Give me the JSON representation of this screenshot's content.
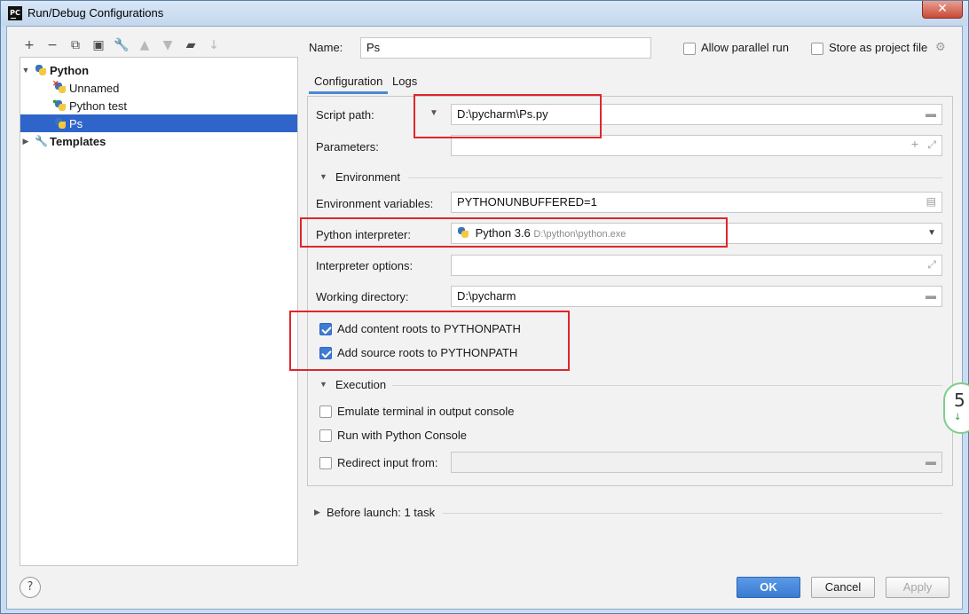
{
  "window": {
    "title": "Run/Debug Configurations",
    "app_icon_text": "PC"
  },
  "toolbar": {
    "icons": [
      "add-icon",
      "remove-icon",
      "copy-icon",
      "save-icon",
      "wrench-icon",
      "move-up-icon",
      "move-down-icon",
      "folder-icon",
      "sort-icon"
    ]
  },
  "tree": {
    "python": "Python",
    "items": [
      "Unnamed",
      "Python test",
      "Ps"
    ],
    "templates": "Templates"
  },
  "header": {
    "name_label": "Name:",
    "name_value": "Ps",
    "allow_parallel": "Allow parallel run",
    "store_as_project": "Store as project file"
  },
  "tabs": [
    "Configuration",
    "Logs"
  ],
  "config": {
    "script_path_label": "Script path:",
    "script_path_value": "D:\\pycharm\\Ps.py",
    "parameters_label": "Parameters:",
    "environment_header": "Environment",
    "env_vars_label": "Environment variables:",
    "env_vars_value": "PYTHONUNBUFFERED=1",
    "interpreter_label": "Python interpreter:",
    "interpreter_name": "Python 3.6",
    "interpreter_path": "D:\\python\\python.exe",
    "interp_options_label": "Interpreter options:",
    "working_dir_label": "Working directory:",
    "working_dir_value": "D:\\pycharm",
    "add_content_roots": "Add content roots to PYTHONPATH",
    "add_source_roots": "Add source roots to PYTHONPATH",
    "execution_header": "Execution",
    "emulate_terminal": "Emulate terminal in output console",
    "run_python_console": "Run with Python Console",
    "redirect_input": "Redirect input from:"
  },
  "before_launch": "Before launch: 1 task",
  "buttons": {
    "ok": "OK",
    "cancel": "Cancel",
    "apply": "Apply",
    "help": "?"
  },
  "side_badge": {
    "value": "5",
    "arrow": "↓"
  },
  "colors": {
    "selection": "#2f65ca",
    "highlight_box": "#e0262b",
    "primary_button": "#3a7bd2"
  }
}
